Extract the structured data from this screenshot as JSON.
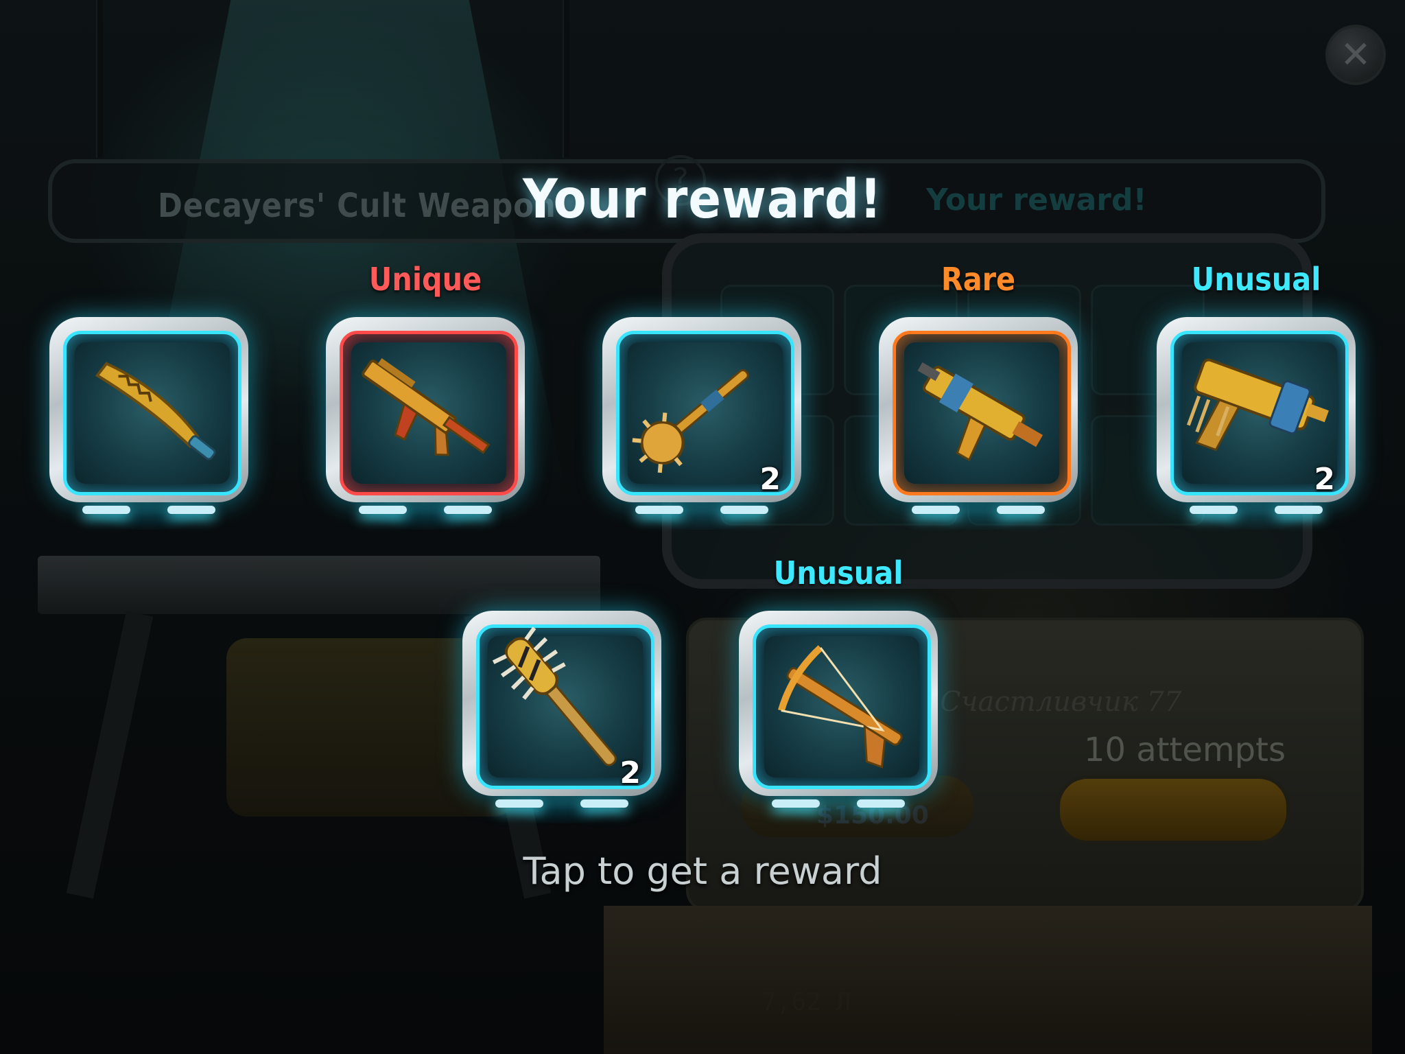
{
  "title": "Your reward!",
  "hint": "Tap to get a reward",
  "close_label": "✕",
  "background": {
    "banner_left": "Decayers' Cult Weapon",
    "banner_right": "Your reward!",
    "help_glyph": "?",
    "attempts": "10 attempts",
    "price": "$150.00",
    "brand": "Счастливчик 77",
    "ammo_marking": "7,62 Л"
  },
  "rewards": [
    {
      "rarity": "",
      "rarity_color": "",
      "frame_style": "common",
      "count": "",
      "icon": "machete-icon"
    },
    {
      "rarity": "Unique",
      "rarity_color": "#ff5a5a",
      "frame_style": "unique",
      "count": "",
      "icon": "assault-rifle-icon"
    },
    {
      "rarity": "",
      "rarity_color": "",
      "frame_style": "common",
      "count": "2",
      "icon": "spiked-mace-icon"
    },
    {
      "rarity": "Rare",
      "rarity_color": "#ff8a2a",
      "frame_style": "rare",
      "count": "",
      "icon": "submachine-gun-icon"
    },
    {
      "rarity": "Unusual",
      "rarity_color": "#3ee8ff",
      "frame_style": "common",
      "count": "2",
      "icon": "machine-pistol-icon"
    },
    {
      "rarity": "",
      "rarity_color": "",
      "frame_style": "common",
      "count": "2",
      "icon": "spiked-club-icon"
    },
    {
      "rarity": "Unusual",
      "rarity_color": "#3ee8ff",
      "frame_style": "common",
      "count": "",
      "icon": "crossbow-icon"
    }
  ]
}
